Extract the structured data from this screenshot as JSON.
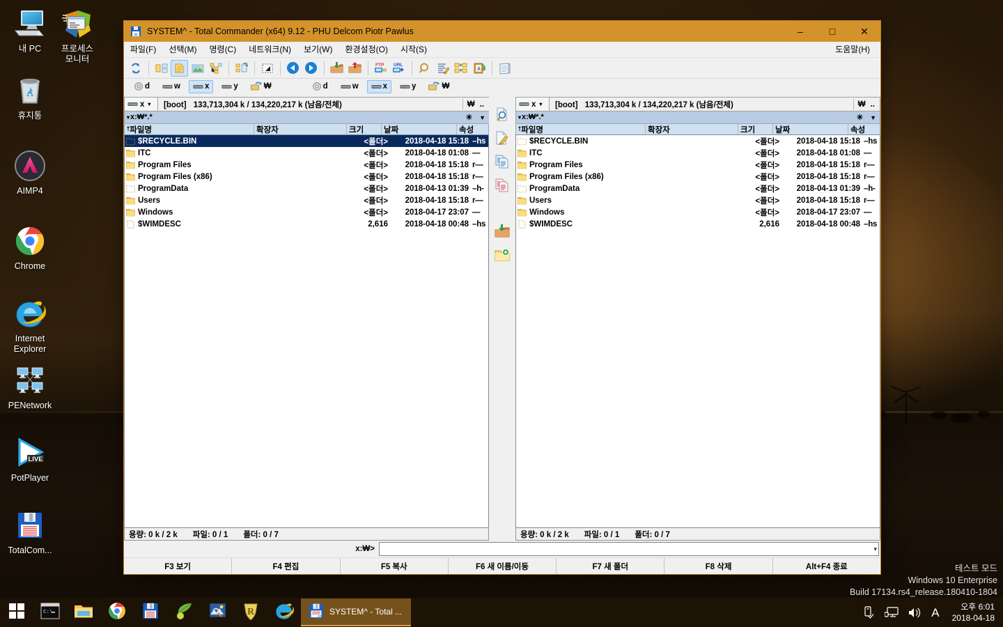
{
  "desktop": {
    "icons": [
      {
        "name": "my-pc",
        "label": "내 PC",
        "icon": "computer-icon"
      },
      {
        "name": "process-monitor",
        "label": "프로세스\n모니터",
        "icon": "process-monitor-icon"
      },
      {
        "name": "recycle-bin",
        "label": "휴지통",
        "icon": "recycle-bin-icon"
      },
      {
        "name": "aimp4",
        "label": "AIMP4",
        "icon": "aimp-icon"
      },
      {
        "name": "chrome",
        "label": "Chrome",
        "icon": "chrome-icon"
      },
      {
        "name": "internet-explorer",
        "label": "Internet\nExplorer",
        "icon": "internet-explorer-icon"
      },
      {
        "name": "penetwork",
        "label": "PENetwork",
        "icon": "network-icon"
      },
      {
        "name": "potplayer",
        "label": "PotPlayer",
        "icon": "potplayer-icon"
      },
      {
        "name": "totalcommander",
        "label": "TotalCom...",
        "icon": "floppy-disk-icon"
      }
    ]
  },
  "watermark": {
    "line1": "테스트 모드",
    "line2": "Windows 10 Enterprise",
    "line3": "Build 17134.rs4_release.180410-1804"
  },
  "window": {
    "title": "SYSTEM^ - Total Commander (x64) 9.12 - PHU Delcom Piotr Pawlus",
    "icon": "floppy-disk-64-icon",
    "minimize_label": "–",
    "maximize_label": "□",
    "close_label": "✕"
  },
  "menu": {
    "items": [
      {
        "name": "menu-file",
        "label": "파일(F)"
      },
      {
        "name": "menu-select",
        "label": "선택(M)"
      },
      {
        "name": "menu-command",
        "label": "명령(C)"
      },
      {
        "name": "menu-network",
        "label": "네트워크(N)"
      },
      {
        "name": "menu-view",
        "label": "보기(W)"
      },
      {
        "name": "menu-config",
        "label": "환경설정(O)"
      },
      {
        "name": "menu-start",
        "label": "시작(S)"
      }
    ],
    "help_label": "도움말(H)"
  },
  "toolbar": {
    "buttons": [
      {
        "name": "refresh-button",
        "icon": "refresh-icon",
        "active": false
      },
      {
        "name": "sep1",
        "icon": "separator",
        "active": false
      },
      {
        "name": "brief-view-button",
        "icon": "brief-view-icon",
        "active": false
      },
      {
        "name": "full-view-button",
        "icon": "full-view-icon",
        "active": true
      },
      {
        "name": "thumbnail-view-button",
        "icon": "thumbnail-view-icon",
        "active": false
      },
      {
        "name": "tree-view-button",
        "icon": "tree-view-icon",
        "active": false
      },
      {
        "name": "sep2",
        "icon": "separator",
        "active": false
      },
      {
        "name": "branch-view-button",
        "icon": "branch-view-icon",
        "active": false
      },
      {
        "name": "sep3",
        "icon": "separator",
        "active": false
      },
      {
        "name": "quick-view-button",
        "icon": "quick-view-icon",
        "active": false
      },
      {
        "name": "sep4",
        "icon": "separator",
        "active": false
      },
      {
        "name": "back-button",
        "icon": "arrow-left-icon",
        "active": false
      },
      {
        "name": "forward-button",
        "icon": "arrow-right-icon",
        "active": false
      },
      {
        "name": "sep5",
        "icon": "separator",
        "active": false
      },
      {
        "name": "pack-button",
        "icon": "pack-icon",
        "active": false
      },
      {
        "name": "unpack-button",
        "icon": "unpack-icon",
        "active": false
      },
      {
        "name": "sep6",
        "icon": "separator",
        "active": false
      },
      {
        "name": "ftp-connect-button",
        "icon": "ftp-icon",
        "active": false
      },
      {
        "name": "ftp-url-button",
        "icon": "url-icon",
        "active": false
      },
      {
        "name": "sep7",
        "icon": "separator",
        "active": false
      },
      {
        "name": "search-button",
        "icon": "magnifier-icon",
        "active": false
      },
      {
        "name": "multi-rename-button",
        "icon": "multi-rename-icon",
        "active": false
      },
      {
        "name": "sync-dirs-button",
        "icon": "sync-dirs-icon",
        "active": false
      },
      {
        "name": "clipboard-button",
        "icon": "clipboard-icon",
        "active": false
      },
      {
        "name": "sep8",
        "icon": "separator",
        "active": false
      },
      {
        "name": "notepad-button",
        "icon": "notepad-icon",
        "active": false
      }
    ]
  },
  "mid_strip": {
    "buttons": [
      {
        "name": "view-file-button",
        "icon": "doc-magnifier-icon"
      },
      {
        "name": "edit-file-button",
        "icon": "doc-pencil-icon"
      },
      {
        "name": "copy-file-button",
        "icon": "copy-docs-icon"
      },
      {
        "name": "move-file-button",
        "icon": "move-docs-icon"
      },
      {
        "name": "gap",
        "icon": "gap"
      },
      {
        "name": "pack-files-button",
        "icon": "folder-down-icon"
      },
      {
        "name": "new-folder-button",
        "icon": "folder-plus-icon"
      }
    ]
  },
  "drive_buttons": [
    {
      "name": "drive-d",
      "label": "d",
      "icon": "cd-drive-icon",
      "active": false
    },
    {
      "name": "drive-w",
      "label": "w",
      "icon": "hard-drive-icon",
      "active": false
    },
    {
      "name": "drive-x",
      "label": "x",
      "icon": "hard-drive-icon",
      "active": true
    },
    {
      "name": "drive-y",
      "label": "y",
      "icon": "hard-drive-icon",
      "active": false
    },
    {
      "name": "drive-network",
      "label": "₩",
      "icon": "network-drive-icon",
      "active": false
    }
  ],
  "panel": {
    "drive_selected": "x",
    "drive_icon": "hard-drive-icon",
    "volume_label": "[boot]",
    "free_total": "133,713,304 k / 134,220,217 k (남음/전체)",
    "root_button": "₩",
    "up_button": "..",
    "tab_label": "x:₩*.*",
    "tab_arrow": "▾",
    "branch_button": "✳",
    "tab_menu_button": "▼",
    "columns": [
      {
        "name": "column-filename",
        "label": "파일명",
        "sort": "⭡"
      },
      {
        "name": "column-extension",
        "label": "확장자"
      },
      {
        "name": "column-size",
        "label": "크기"
      },
      {
        "name": "column-date",
        "label": "날짜"
      },
      {
        "name": "column-attr",
        "label": "속성"
      }
    ],
    "files": [
      {
        "name": "$RECYCLE.BIN",
        "ext": "",
        "size": "<폴더>",
        "date": "2018-04-18 15:18",
        "attr": "–hs",
        "icon": "folder-hidden-icon"
      },
      {
        "name": "ITC",
        "ext": "",
        "size": "<폴더>",
        "date": "2018-04-18 01:08",
        "attr": "—",
        "icon": "folder-icon"
      },
      {
        "name": "Program Files",
        "ext": "",
        "size": "<폴더>",
        "date": "2018-04-18 15:18",
        "attr": "r—",
        "icon": "folder-icon"
      },
      {
        "name": "Program Files (x86)",
        "ext": "",
        "size": "<폴더>",
        "date": "2018-04-18 15:18",
        "attr": "r—",
        "icon": "folder-icon"
      },
      {
        "name": "ProgramData",
        "ext": "",
        "size": "<폴더>",
        "date": "2018-04-13 01:39",
        "attr": "–h-",
        "icon": "folder-hidden-icon"
      },
      {
        "name": "Users",
        "ext": "",
        "size": "<폴더>",
        "date": "2018-04-18 15:18",
        "attr": "r—",
        "icon": "folder-icon"
      },
      {
        "name": "Windows",
        "ext": "",
        "size": "<폴더>",
        "date": "2018-04-17 23:07",
        "attr": "—",
        "icon": "folder-icon"
      },
      {
        "name": "$WIMDESC",
        "ext": "",
        "size": "2,616",
        "date": "2018-04-18 00:48",
        "attr": "–hs",
        "icon": "file-hidden-icon"
      }
    ],
    "selected_index": 0,
    "status": {
      "size_label": "용량: 0 k / 2 k",
      "files_label": "파일: 0 / 1",
      "folders_label": "폴더: 0 / 7"
    }
  },
  "command_line": {
    "prompt": "x:₩>",
    "value": "",
    "placeholder": ""
  },
  "function_keys": [
    {
      "name": "fkey-f3-view",
      "label": "F3 보기"
    },
    {
      "name": "fkey-f4-edit",
      "label": "F4 편집"
    },
    {
      "name": "fkey-f5-copy",
      "label": "F5 복사"
    },
    {
      "name": "fkey-f6-rename",
      "label": "F6 새 이름/이동"
    },
    {
      "name": "fkey-f7-newdir",
      "label": "F7 새 폴더"
    },
    {
      "name": "fkey-f8-delete",
      "label": "F8 삭제"
    },
    {
      "name": "fkey-altf4-exit",
      "label": "Alt+F4 종료"
    }
  ],
  "taskbar": {
    "start_icon": "windows-start-icon",
    "pinned": [
      {
        "name": "taskbar-cmd",
        "icon": "command-prompt-icon"
      },
      {
        "name": "taskbar-explorer",
        "icon": "file-explorer-icon"
      },
      {
        "name": "taskbar-chrome",
        "icon": "chrome-icon"
      },
      {
        "name": "taskbar-totalcmd",
        "icon": "floppy-disk-icon"
      },
      {
        "name": "taskbar-leaf-app",
        "icon": "leaf-icon"
      },
      {
        "name": "taskbar-imageviewer",
        "icon": "image-viewer-icon"
      },
      {
        "name": "taskbar-r-app",
        "icon": "r-shield-icon"
      },
      {
        "name": "taskbar-ie",
        "icon": "internet-explorer-icon"
      }
    ],
    "active_window": {
      "name": "taskbar-active-window",
      "label": "SYSTEM^ - Total ...",
      "icon": "floppy-disk-64-icon"
    },
    "tray": [
      {
        "name": "usb-eject-icon"
      },
      {
        "name": "network-icon"
      },
      {
        "name": "volume-icon"
      },
      {
        "name": "input-language-icon",
        "label": "A"
      }
    ],
    "clock": {
      "time": "오후 6:01",
      "date": "2018-04-18"
    }
  },
  "colors": {
    "titlebar": "#d4922a",
    "selection": "#0a2a5e",
    "tabstrip": "#b8cde4",
    "colheader": "#cfe0f0",
    "taskbar": "#1d1206"
  }
}
